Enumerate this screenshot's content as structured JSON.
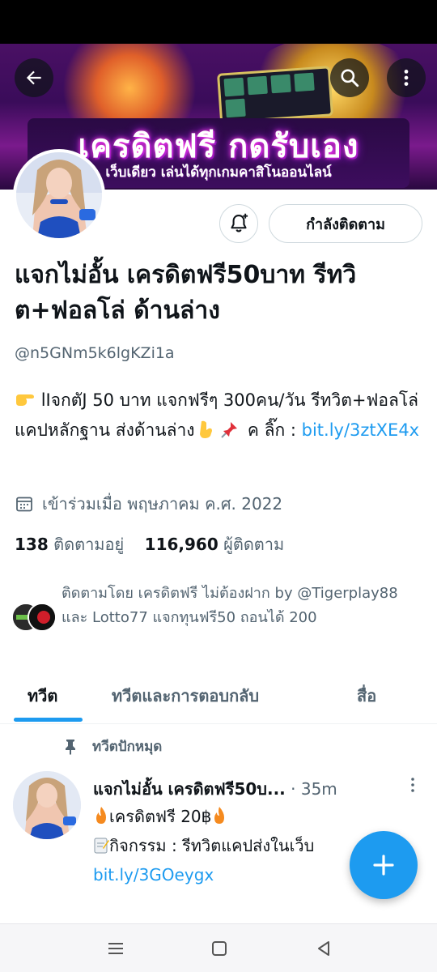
{
  "header": {
    "banner_headline": "เครดิตฟรี กดรับเอง",
    "banner_subline": "เว็บเดียว เล่นได้ทุกเกมคาสิโนออนไลน์"
  },
  "profile": {
    "display_name": "แจกไม่อั้น เครดิตฟรี50บาท รีทวิต+ฟอลโล่ ด้านล่าง",
    "handle": "@n5GNm5k6lgKZi1a",
    "following_button": "กำลังติดตาม",
    "bio_prefix": "lIจกตัJ 50 บาท แจกฟรีๆ 300คน/วัน รีทวิต+ฟอลโล่ แคปหลักฐาน ส่งด้านล่าง",
    "bio_mid": " ค ลิ๊ก : ",
    "bio_link": "bit.ly/3ztXE4x",
    "joined": "เข้าร่วมเมื่อ พฤษภาคม ค.ศ. 2022",
    "following_count": "138",
    "following_label": "ติดตามอยู่",
    "followers_count": "116,960",
    "followers_label": "ผู้ติดตาม",
    "followed_by": "ติดตามโดย เครดิตฟรี ไม่ต้องฝาก by @Tigerplay88 และ Lotto77 แจกทุนฟรี50 ถอนได้ 200"
  },
  "tabs": [
    {
      "label": "ทวีต"
    },
    {
      "label": "ทวีตและการตอบกลับ"
    },
    {
      "label": "สื่อ"
    }
  ],
  "tweet": {
    "pinned_label": "ทวีตปักหมุด",
    "author": "แจกไม่อั้น เครดิตฟรี50บ...",
    "time": "35m",
    "line1": "เครดิตฟรี 20฿",
    "line2": "กิจกรรม : รีทวิตแคปส่งในเว็บ",
    "link": "bit.ly/3GOeygx"
  },
  "colors": {
    "accent": "#1d9bf0",
    "text_primary": "#0f1419",
    "text_secondary": "#536471"
  }
}
